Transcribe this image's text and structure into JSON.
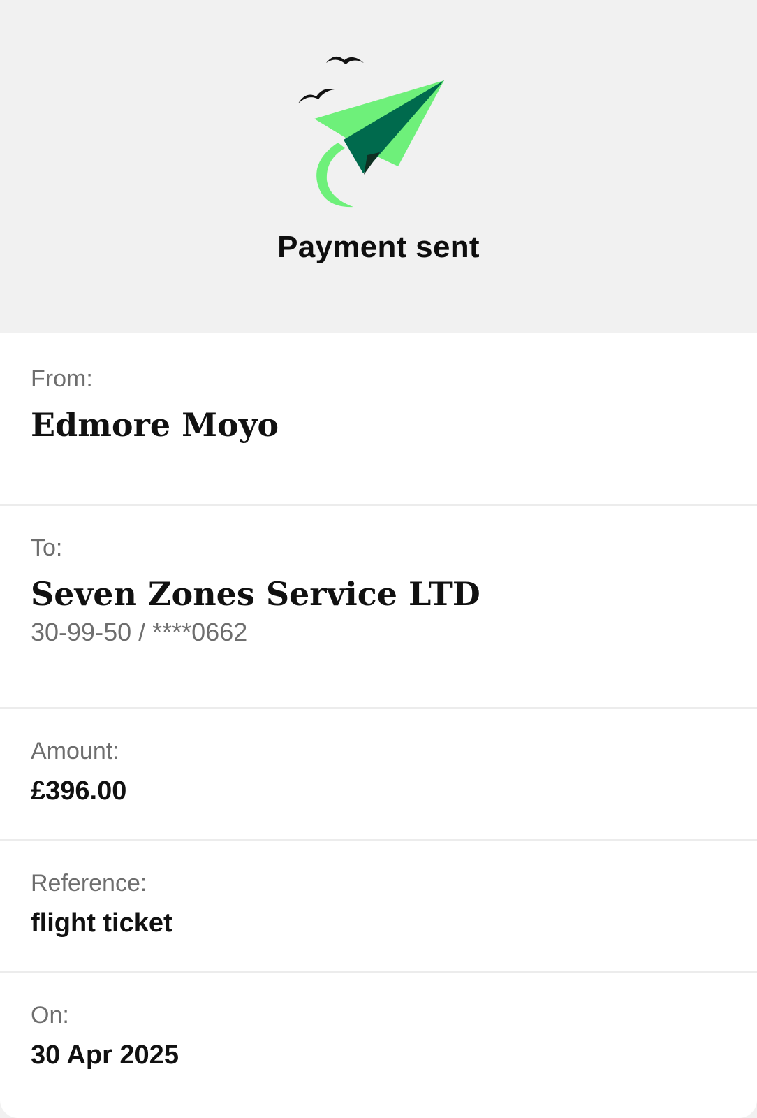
{
  "header": {
    "illustration_icon": "paper-plane-icon",
    "title": "Payment sent"
  },
  "details": {
    "from": {
      "label": "From:",
      "value": "Edmore Moyo"
    },
    "to": {
      "label": "To:",
      "value": "Seven Zones Service LTD",
      "account": "30-99-50 / ****0662"
    },
    "amount": {
      "label": "Amount:",
      "value": "£396.00"
    },
    "reference": {
      "label": "Reference:",
      "value": "flight ticket"
    },
    "on": {
      "label": "On:",
      "value": "30 Apr 2025"
    }
  },
  "colors": {
    "background": "#f1f1f1",
    "card": "#ffffff",
    "accent_light_green": "#6ef07a",
    "accent_dark_green": "#006a4d",
    "divider": "#ececec",
    "label_grey": "#6e6e6e",
    "text": "#111111"
  }
}
